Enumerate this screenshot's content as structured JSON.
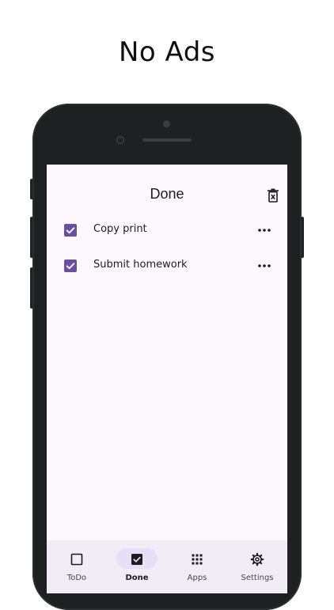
{
  "promo": {
    "title": "No Ads"
  },
  "app": {
    "title": "Done",
    "accent_color": "#6750a4",
    "background_color": "#fdf7fe",
    "navbar_color": "#f2ecf6",
    "delete_all_icon": "trash-icon"
  },
  "items": [
    {
      "label": "Copy print",
      "checked": true,
      "menu_icon": "more-horizontal-icon"
    },
    {
      "label": "Submit homework",
      "checked": true,
      "menu_icon": "more-horizontal-icon"
    }
  ],
  "nav": [
    {
      "label": "ToDo",
      "icon": "checkbox-empty-icon",
      "active": false
    },
    {
      "label": "Done",
      "icon": "checkbox-checked-icon",
      "active": true
    },
    {
      "label": "Apps",
      "icon": "grid-icon",
      "active": false
    },
    {
      "label": "Settings",
      "icon": "gear-icon",
      "active": false
    }
  ]
}
